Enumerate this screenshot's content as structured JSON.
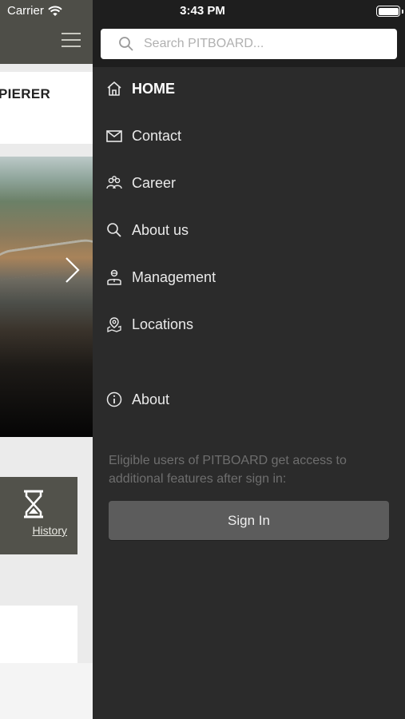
{
  "status_bar": {
    "carrier": "Carrier",
    "time": "3:43 PM"
  },
  "background_app": {
    "brand_text": "PIERER",
    "history_label": "History"
  },
  "drawer": {
    "search": {
      "placeholder": "Search PITBOARD..."
    },
    "menu": [
      {
        "label": "HOME",
        "icon": "home-icon",
        "active": true
      },
      {
        "label": "Contact",
        "icon": "envelope-icon"
      },
      {
        "label": "Career",
        "icon": "people-icon"
      },
      {
        "label": "About us",
        "icon": "search-icon"
      },
      {
        "label": "Management",
        "icon": "manager-icon"
      },
      {
        "label": "Locations",
        "icon": "map-pin-icon"
      },
      {
        "label": "About",
        "icon": "info-icon"
      }
    ],
    "note": "Eligible users of PITBOARD get access to additional features after sign in:",
    "sign_in_label": "Sign In"
  },
  "colors": {
    "drawer_bg": "#2b2b2b",
    "header_bg": "#4e4e48",
    "button_bg": "#5c5c5c"
  }
}
